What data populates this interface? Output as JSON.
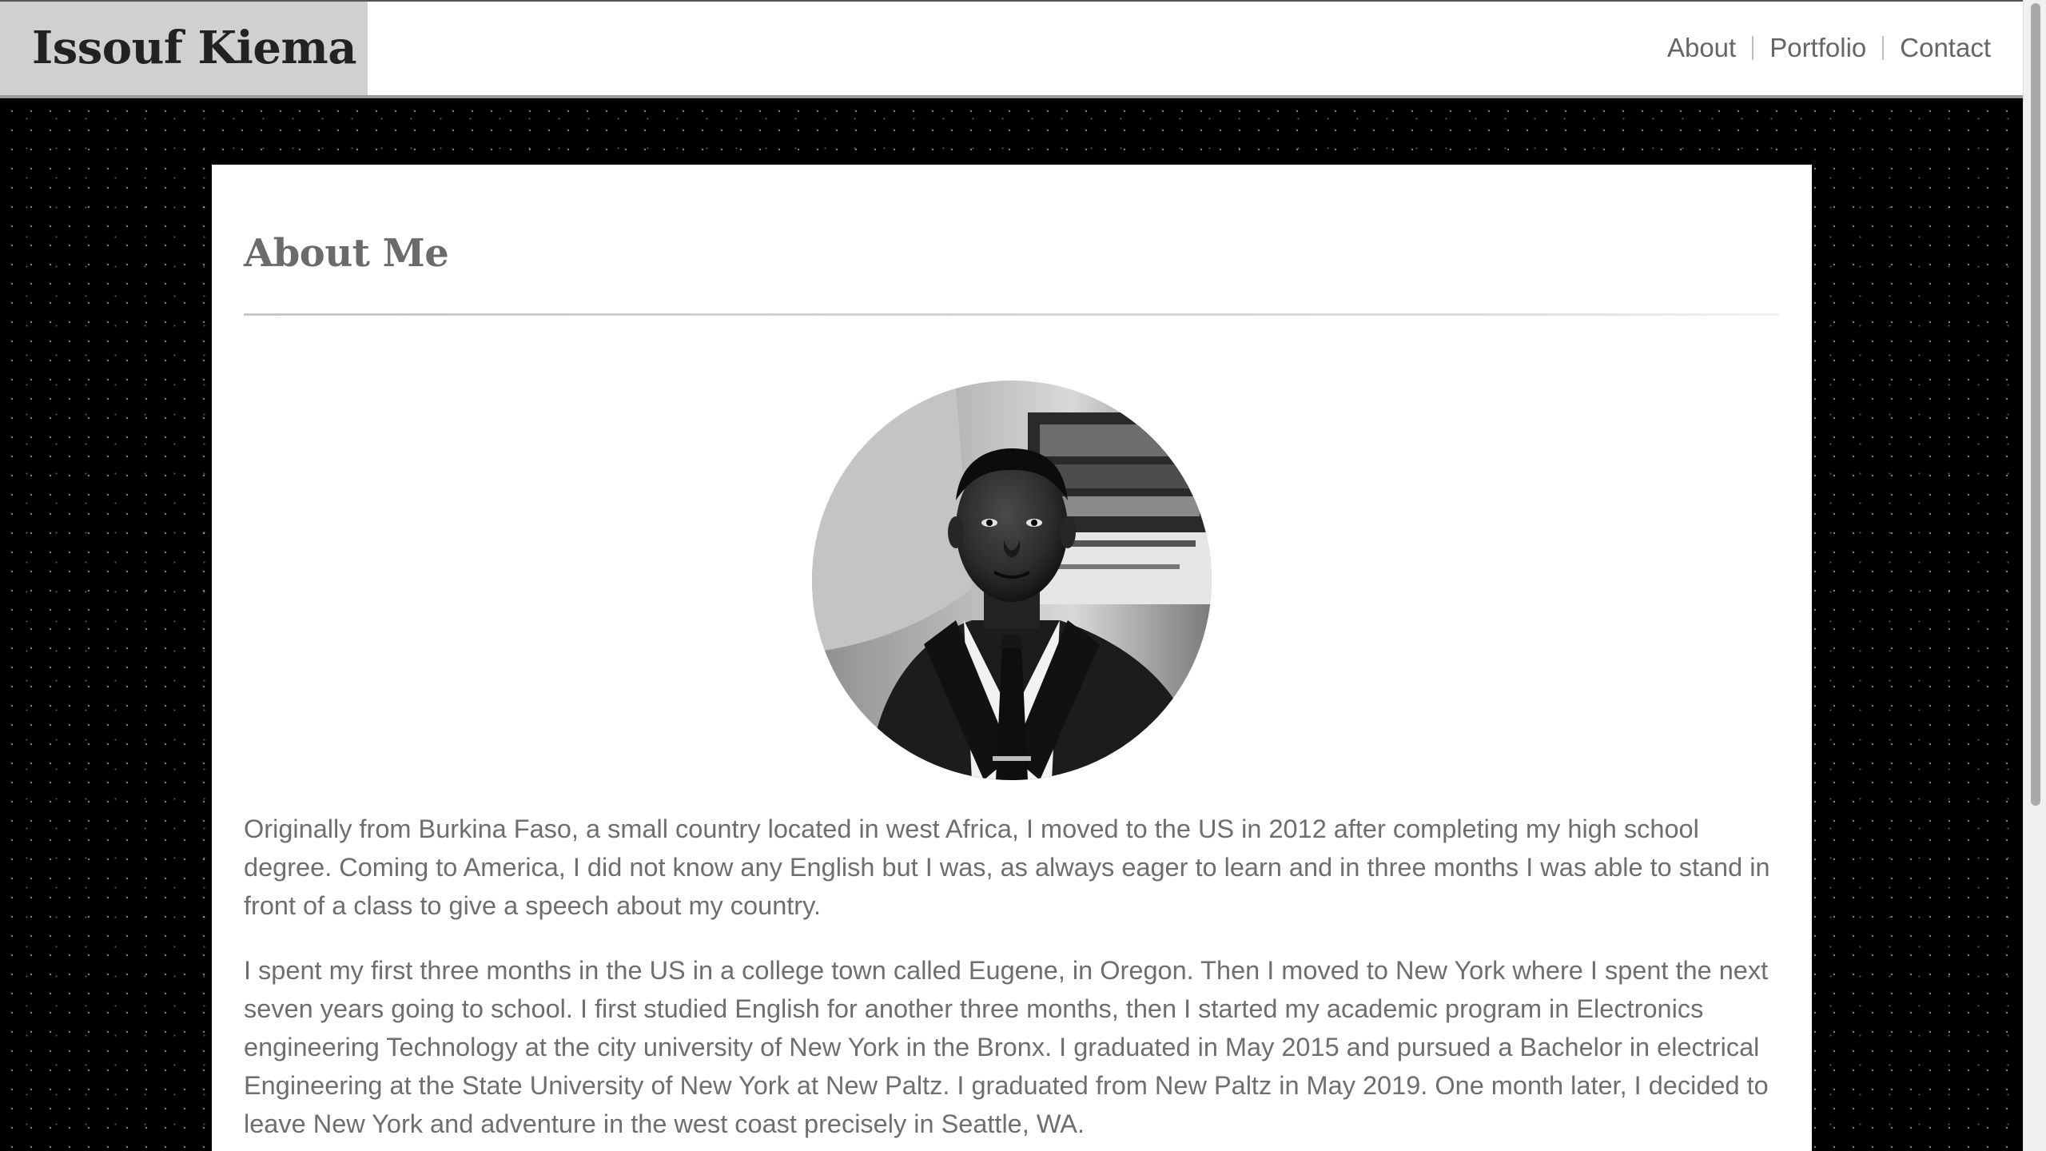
{
  "header": {
    "brand": "Issouf Kiema",
    "nav": [
      {
        "label": "About"
      },
      {
        "label": "Portfolio"
      },
      {
        "label": "Contact"
      }
    ]
  },
  "main": {
    "title": "About Me",
    "photo_alt": "Portrait photo of Issouf Kiema",
    "paragraphs": [
      "Originally from Burkina Faso, a small country located in west Africa, I moved to the US in 2012 after completing my high school degree. Coming to America, I did not know any English but I was, as always eager to learn and in three months I was able to stand in front of a class to give a speech about my country.",
      "I spent my first three months in the US in a college town called Eugene, in Oregon. Then I moved to New York where I spent the next seven years going to school. I first studied English for another three months, then I started my academic program in Electronics engineering Technology at the city university of New York in the Bronx. I graduated in May 2015 and pursued a Bachelor in electrical Engineering at the State University of New York at New Paltz. I graduated from New Paltz in May 2019. One month later, I decided to leave New York and adventure in the west coast precisely in Seattle, WA."
    ]
  },
  "colors": {
    "page_background": "#000000",
    "header_background": "#ffffff",
    "brand_box_background": "#d0d0d0",
    "card_background": "#ffffff",
    "body_text": "#6e6e6e",
    "nav_text": "#666666"
  }
}
